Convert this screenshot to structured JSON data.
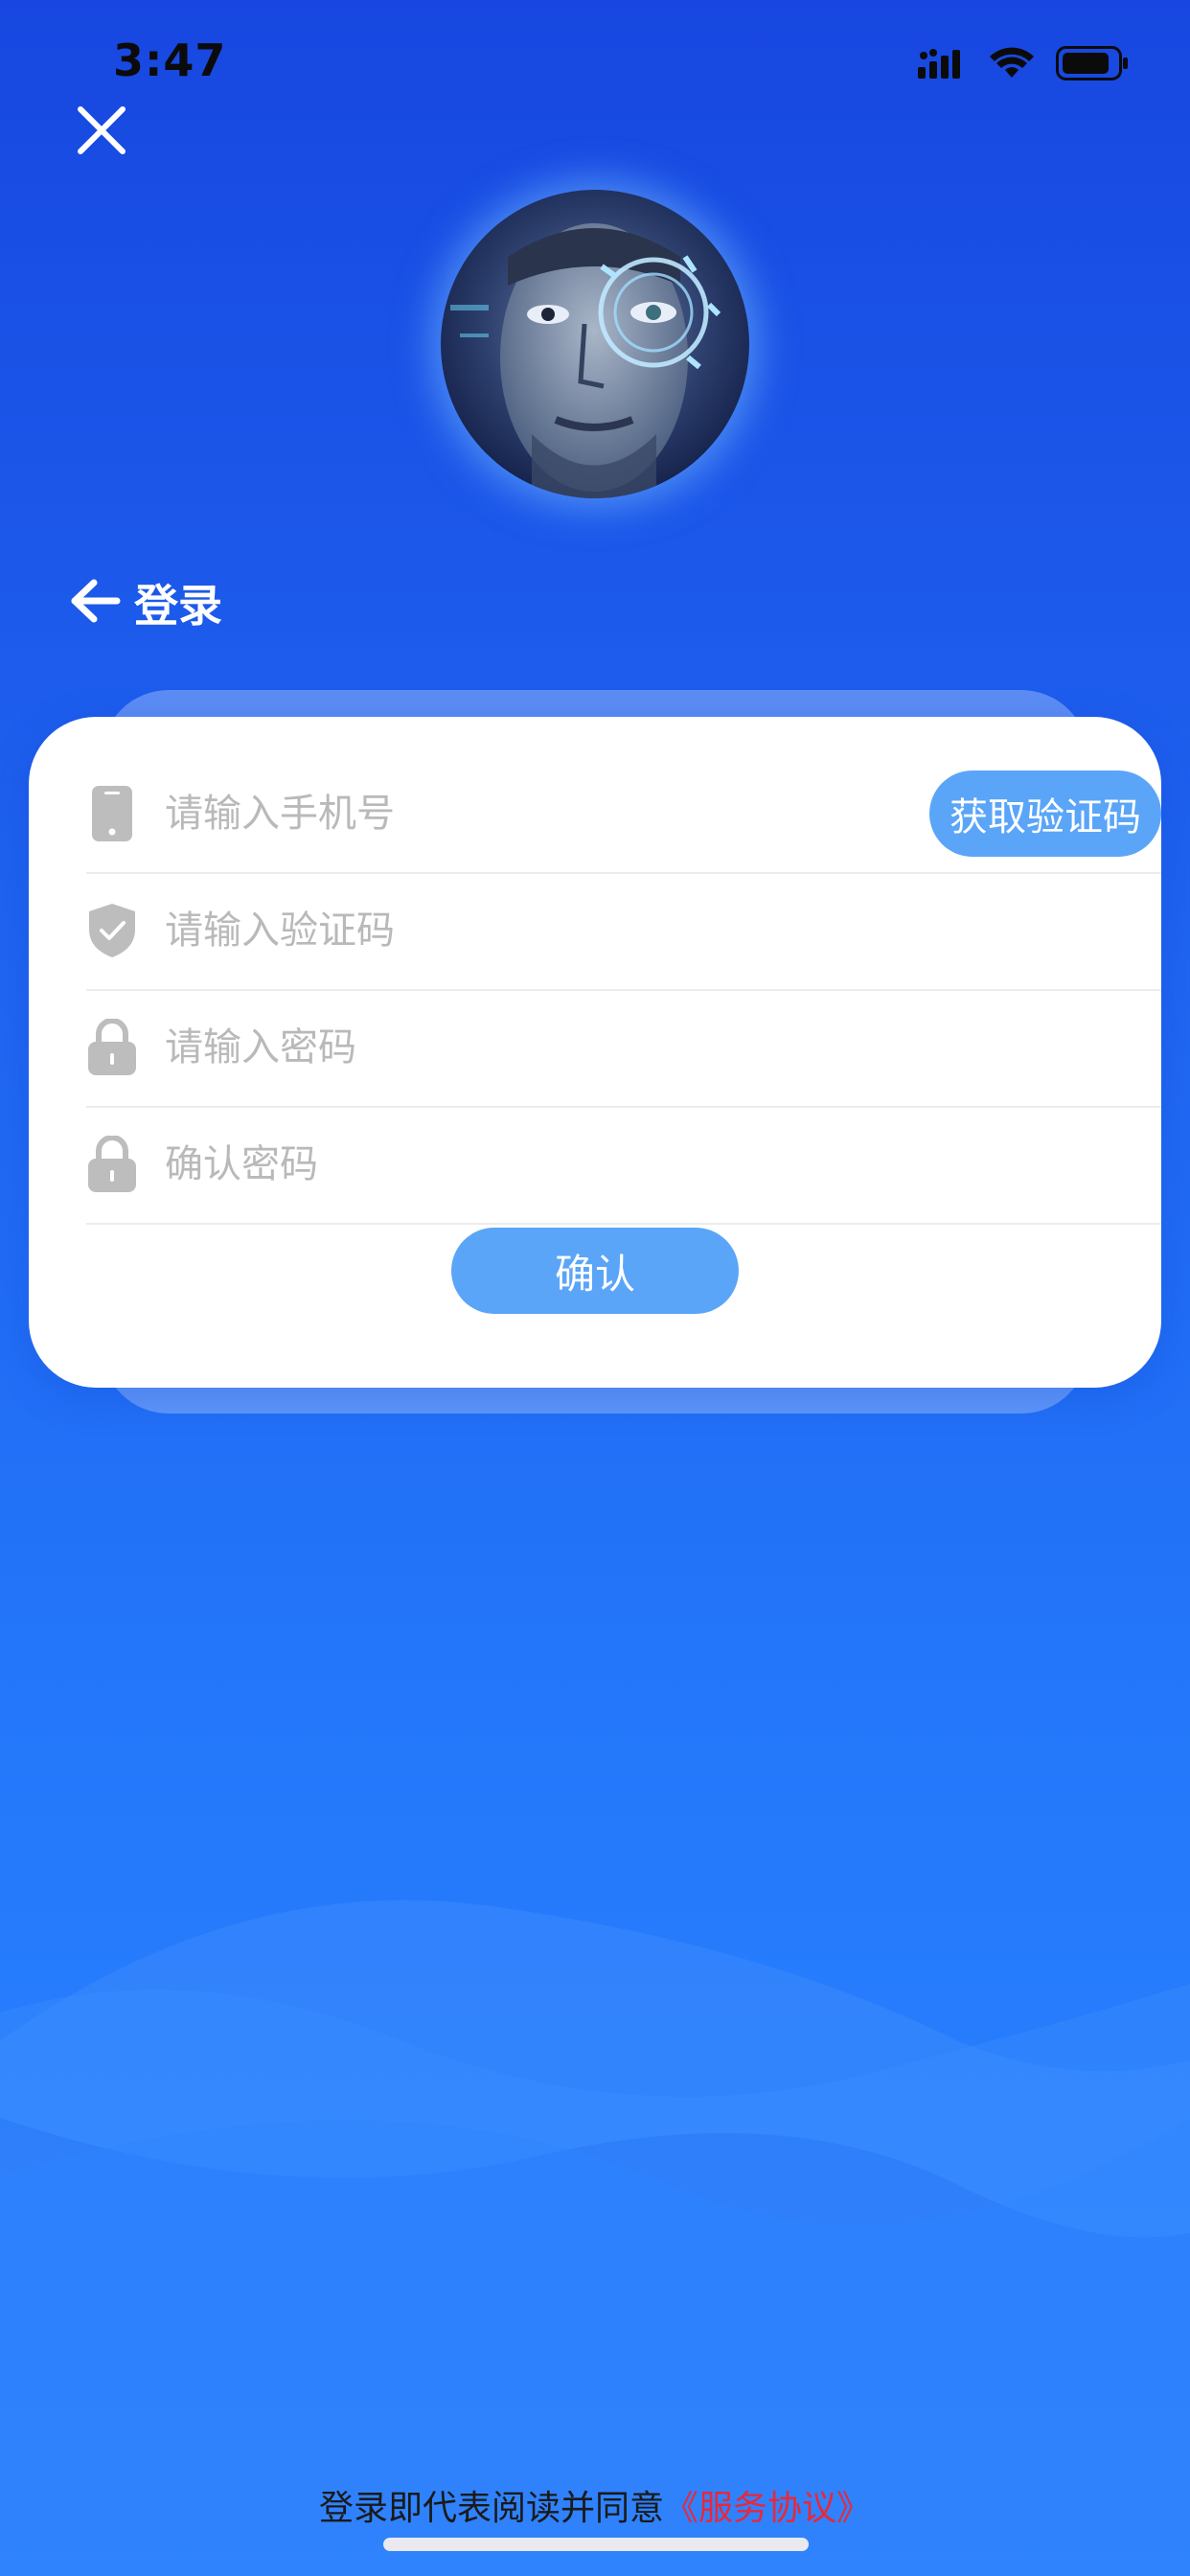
{
  "status_bar": {
    "time": "3:47",
    "icons": [
      "signal-icon",
      "wifi-icon",
      "battery-icon"
    ]
  },
  "close": {
    "icon": "close-icon"
  },
  "avatar": {
    "description": "avatar"
  },
  "header": {
    "back_icon": "arrow-left-icon",
    "title": "登录"
  },
  "form": {
    "phone": {
      "placeholder": "请输入手机号",
      "icon": "phone-icon"
    },
    "get_code_label": "获取验证码",
    "code": {
      "placeholder": "请输入验证码",
      "icon": "shield-icon"
    },
    "password": {
      "placeholder": "请输入密码",
      "icon": "lock-icon"
    },
    "confirm_password": {
      "placeholder": "确认密码",
      "icon": "lock-icon"
    },
    "confirm_label": "确认"
  },
  "footer": {
    "agreement_prefix": "登录即代表阅读并同意",
    "agreement_link": "《服务协议》"
  },
  "colors": {
    "background_top": "#1747e0",
    "background_bottom": "#2a85ff",
    "button": "#5aa5f8",
    "link": "#e8283a",
    "placeholder": "#b9b9b9"
  }
}
